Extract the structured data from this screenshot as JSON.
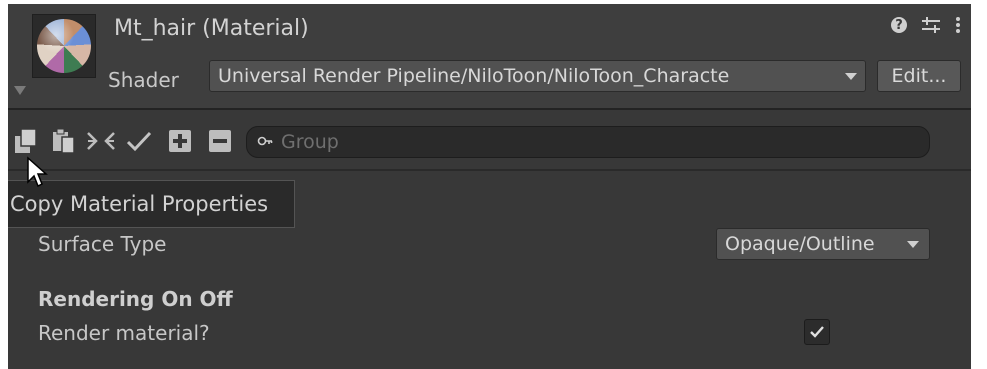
{
  "header": {
    "title": "Mt_hair (Material)",
    "shader_label": "Shader",
    "shader_value": "Universal Render Pipeline/NiloToon/NiloToon_Characte",
    "edit_button": "Edit...",
    "icons": [
      "help-icon",
      "preset-icon",
      "kebab-menu-icon"
    ]
  },
  "toolbar": {
    "icons": [
      "copy-icon",
      "paste-icon",
      "collapse-icon",
      "check-icon",
      "expand-all-icon",
      "collapse-all-icon"
    ],
    "search_placeholder": "Group"
  },
  "tooltip": {
    "text": "Copy Material Properties"
  },
  "properties": {
    "surface_type_label": "Surface Type",
    "surface_type_value": "Opaque/Outline",
    "section_title": "Rendering On Off",
    "render_material_label": "Render material?",
    "render_material_checked": true
  },
  "colors": {
    "panel_bg": "#383838",
    "header_bg": "#3e3e3e",
    "field_bg": "#515151",
    "text": "#c4c4c4"
  }
}
